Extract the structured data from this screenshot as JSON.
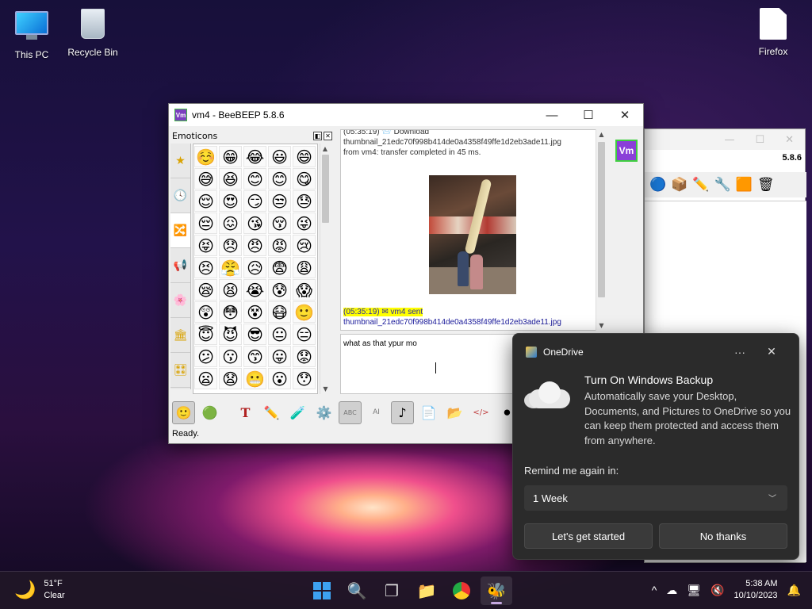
{
  "desktop": {
    "icons": [
      {
        "label": "This PC",
        "icon": "this-pc-icon"
      },
      {
        "label": "Recycle Bin",
        "icon": "recycle-bin-icon"
      },
      {
        "label": "Firefox",
        "icon": "shortcut-file-icon"
      }
    ]
  },
  "beebeep": {
    "title": "vm4 - BeeBEEP 5.8.6",
    "emoticons_title": "Emoticons",
    "emoticon_tabs": [
      "★",
      "🕓",
      "🔀",
      "📢",
      "🌸",
      "🏛",
      "🎛"
    ],
    "emoticons": [
      "☺️",
      "😁",
      "😂",
      "😃",
      "😄",
      "😅",
      "😆",
      "😊",
      "😊",
      "😋",
      "😌",
      "😍",
      "😏",
      "😒",
      "😓",
      "😔",
      "😖",
      "😘",
      "😚",
      "😜",
      "😝",
      "😞",
      "😠",
      "😡",
      "😢",
      "😣",
      "😤",
      "😥",
      "😨",
      "😩",
      "😪",
      "😫",
      "😭",
      "😰",
      "😱",
      "😲",
      "😳",
      "😵",
      "😷",
      "🙂",
      "😇",
      "😈",
      "😎",
      "😐",
      "😑",
      "😕",
      "😗",
      "😙",
      "😛",
      "😟",
      "😦",
      "😧",
      "😬",
      "😮",
      "😯"
    ],
    "chat": {
      "line1": "(05:35:19) 📨 Download",
      "line2": "thumbnail_21edc70f998b414de0a4358f49ffe1d2eb3ade11.jpg",
      "line3": "from vm4: transfer completed in 45 ms.",
      "sent_line": "(05:35:19) ✉ vm4 sent",
      "sent_file": "thumbnail_21edc70f998b414de0a4358f49ffe1d2eb3ade11.jpg"
    },
    "input_text": "what as that ypur mo",
    "toolbar": [
      "🙂",
      "🟢",
      "T",
      "✏️",
      "🧪",
      "⚙️",
      "ABC",
      "AI",
      "♪",
      "📄",
      "📂",
      "</>",
      "⚫"
    ],
    "status": "Ready.",
    "side_badge": "Vm"
  },
  "background_window": {
    "version": "5.8.6",
    "tools": [
      "🔵",
      "📦",
      "✏️",
      "🔧",
      "🟧",
      "🗑"
    ]
  },
  "onedrive": {
    "app_name": "OneDrive",
    "more": "···",
    "close": "✕",
    "title": "Turn On Windows Backup",
    "body": "Automatically save your Desktop, Documents, and Pictures to OneDrive so you can keep them protected and access them from anywhere.",
    "remind_label": "Remind me again in:",
    "remind_value": "1 Week",
    "primary_button": "Let's get started",
    "secondary_button": "No thanks"
  },
  "taskbar": {
    "temperature": "51°F",
    "condition": "Clear",
    "apps": [
      "start",
      "search",
      "task-view",
      "file-explorer",
      "chrome",
      "beebeep"
    ],
    "time": "5:38 AM",
    "date": "10/10/2023",
    "tray_chevron": "^"
  }
}
